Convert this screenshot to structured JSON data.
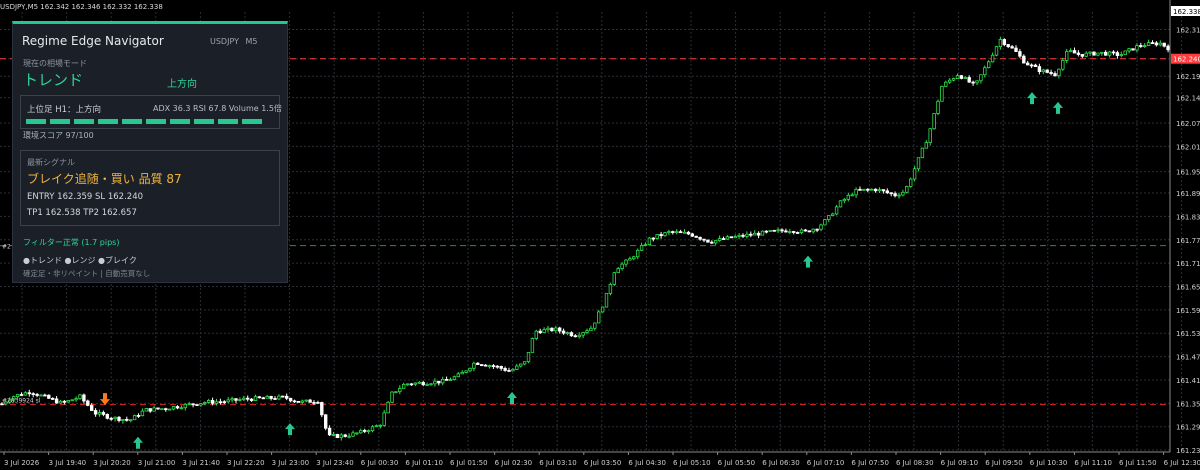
{
  "window": {
    "header": "USDJPY,M5  162.342 162.346 162.332 162.338"
  },
  "colors": {
    "background": "#000000",
    "grid": "#2a2f36",
    "bull_candle": "#2ee04a",
    "bear_candle": "#ffffff",
    "up_arrow": "#27c792",
    "down_arrow": "#ff7a1a",
    "bid_line": "#ff3b3b",
    "sl_line": "#c41f1f",
    "entry_line": "#2c8f3d",
    "price_tag": "#ff3b3b"
  },
  "panel": {
    "title": "Regime Edge Navigator",
    "symbol": "USDJPY  M5",
    "mode_label": "現在の相場モード",
    "mode_value": "トレンド",
    "direction_value": "上方向",
    "h1_text": "上位足 H1：上方向",
    "stats_text": "ADX 36.3  RSI 67.8  Volume 1.5倍",
    "score_text": "環境スコア 97/100",
    "score_fraction": 0.97,
    "signal_label": "最新シグナル",
    "signal_title": "ブレイク追随・買い  品質 87",
    "entry_text": "ENTRY 162.359   SL 162.240",
    "tp_text": "TP1 162.538   TP2 162.657",
    "filter_text": "フィルター正常 (1.7 pips)",
    "legend_text": "●トレンド  ●レンジ  ●ブレイク",
    "footer_text": "確定足・非リペイント | 自動売買なし",
    "bar_segments": 10
  },
  "chart_data": {
    "type": "candlestick",
    "symbol": "USDJPY",
    "timeframe": "M5",
    "ylim": [
      161.23,
      162.36
    ],
    "y_ticks": [
      162.315,
      162.24,
      162.195,
      162.14,
      162.075,
      162.015,
      161.95,
      161.895,
      161.835,
      161.775,
      161.715,
      161.655,
      161.595,
      161.535,
      161.475,
      161.415,
      161.355,
      161.295,
      161.235
    ],
    "x_ticks": [
      "3 Jul 2026",
      "3 Jul 19:40",
      "3 Jul 20:20",
      "3 Jul 21:00",
      "3 Jul 21:40",
      "3 Jul 22:20",
      "3 Jul 23:00",
      "3 Jul 23:40",
      "6 Jul 00:30",
      "6 Jul 01:10",
      "6 Jul 01:50",
      "6 Jul 02:30",
      "6 Jul 03:10",
      "6 Jul 03:50",
      "6 Jul 04:30",
      "6 Jul 05:10",
      "6 Jul 05:50",
      "6 Jul 06:30",
      "6 Jul 07:10",
      "6 Jul 07:50",
      "6 Jul 08:30",
      "6 Jul 09:10",
      "6 Jul 09:50",
      "6 Jul 10:30",
      "6 Jul 11:10",
      "6 Jul 11:50",
      "6 Jul 12:30"
    ],
    "price_path": [
      [
        0,
        161.35
      ],
      [
        12,
        161.372
      ],
      [
        30,
        161.385
      ],
      [
        48,
        161.368
      ],
      [
        62,
        161.355
      ],
      [
        80,
        161.372
      ],
      [
        95,
        161.33
      ],
      [
        112,
        161.318
      ],
      [
        130,
        161.312
      ],
      [
        145,
        161.338
      ],
      [
        165,
        161.342
      ],
      [
        185,
        161.35
      ],
      [
        205,
        161.358
      ],
      [
        225,
        161.36
      ],
      [
        245,
        161.366
      ],
      [
        265,
        161.368
      ],
      [
        285,
        161.37
      ],
      [
        300,
        161.358
      ],
      [
        318,
        161.362
      ],
      [
        328,
        161.27
      ],
      [
        345,
        161.272
      ],
      [
        360,
        161.28
      ],
      [
        380,
        161.3
      ],
      [
        392,
        161.38
      ],
      [
        405,
        161.405
      ],
      [
        425,
        161.408
      ],
      [
        445,
        161.412
      ],
      [
        460,
        161.428
      ],
      [
        475,
        161.46
      ],
      [
        495,
        161.45
      ],
      [
        510,
        161.438
      ],
      [
        525,
        161.46
      ],
      [
        535,
        161.54
      ],
      [
        555,
        161.545
      ],
      [
        575,
        161.53
      ],
      [
        592,
        161.55
      ],
      [
        605,
        161.62
      ],
      [
        615,
        161.7
      ],
      [
        630,
        161.725
      ],
      [
        650,
        161.778
      ],
      [
        670,
        161.795
      ],
      [
        690,
        161.79
      ],
      [
        710,
        161.77
      ],
      [
        730,
        161.78
      ],
      [
        750,
        161.788
      ],
      [
        770,
        161.795
      ],
      [
        790,
        161.8
      ],
      [
        805,
        161.795
      ],
      [
        818,
        161.808
      ],
      [
        828,
        161.83
      ],
      [
        840,
        161.87
      ],
      [
        855,
        161.9
      ],
      [
        875,
        161.905
      ],
      [
        895,
        161.89
      ],
      [
        905,
        161.9
      ],
      [
        915,
        161.96
      ],
      [
        928,
        162.04
      ],
      [
        942,
        162.17
      ],
      [
        958,
        162.2
      ],
      [
        975,
        162.17
      ],
      [
        988,
        162.23
      ],
      [
        1000,
        162.29
      ],
      [
        1015,
        162.26
      ],
      [
        1025,
        162.23
      ],
      [
        1040,
        162.21
      ],
      [
        1055,
        162.2
      ],
      [
        1068,
        162.26
      ],
      [
        1080,
        162.25
      ],
      [
        1100,
        162.255
      ],
      [
        1120,
        162.25
      ],
      [
        1140,
        162.275
      ],
      [
        1160,
        162.28
      ],
      [
        1172,
        162.262
      ]
    ],
    "lines": [
      {
        "name": "bid",
        "value": 162.24,
        "style": "dashed"
      },
      {
        "name": "sl",
        "value": 161.352,
        "style": "dashed"
      },
      {
        "name": "entry",
        "value": 161.76,
        "style": "dashed"
      }
    ],
    "arrows": [
      {
        "x": 105,
        "price": 161.34,
        "dir": "down"
      },
      {
        "x": 138,
        "price": 161.3,
        "dir": "up"
      },
      {
        "x": 290,
        "price": 161.335,
        "dir": "up"
      },
      {
        "x": 512,
        "price": 161.415,
        "dir": "up"
      },
      {
        "x": 808,
        "price": 161.765,
        "dir": "up"
      },
      {
        "x": 1032,
        "price": 162.185,
        "dir": "up"
      },
      {
        "x": 1058,
        "price": 162.16,
        "dir": "up"
      }
    ],
    "bid_label": "162.240",
    "top_label": "162.338",
    "left_labels": [
      "#2",
      "#2839924 sl"
    ]
  }
}
